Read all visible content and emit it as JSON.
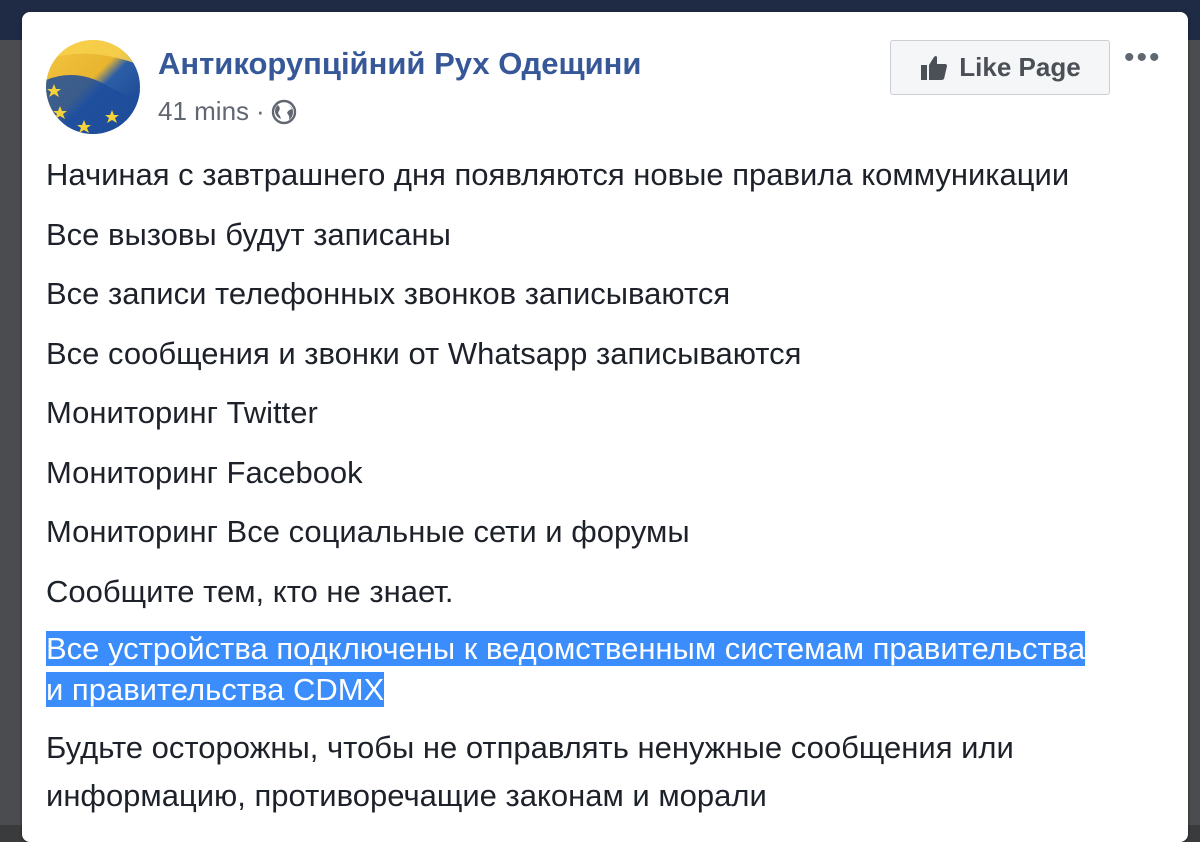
{
  "post": {
    "page_name": "Антикорупційний Рух Одещини",
    "time": "41 mins",
    "separator": "·",
    "like_button_label": "Like Page",
    "more_label": "•••",
    "lines": [
      "Начиная с завтрашнего дня появляются новые правила коммуникации",
      "Все вызовы будут записаны",
      "Все записи телефонных звонков записываются",
      "Все сообщения и звонки от Whatsapp записываются",
      "Мониторинг Twitter",
      "Мониторинг Facebook",
      "Мониторинг Все социальные сети и форумы",
      "Сообщите тем, кто не знает."
    ],
    "highlighted_line_1": "Все устройства подключены к ведомственным системам правительства",
    "highlighted_line_2": "и правительства CDMX",
    "warning_line_1": "Будьте осторожны, чтобы не отправлять ненужные сообщения или",
    "warning_line_2": "информацию, противоречащие законам и морали"
  },
  "icons": {
    "avatar": "eu-flag-avatar",
    "privacy": "globe-icon",
    "like": "thumbs-up-icon"
  },
  "colors": {
    "link": "#365899",
    "highlight": "#3b8dfc",
    "text": "#1d2129",
    "meta": "#616770"
  }
}
